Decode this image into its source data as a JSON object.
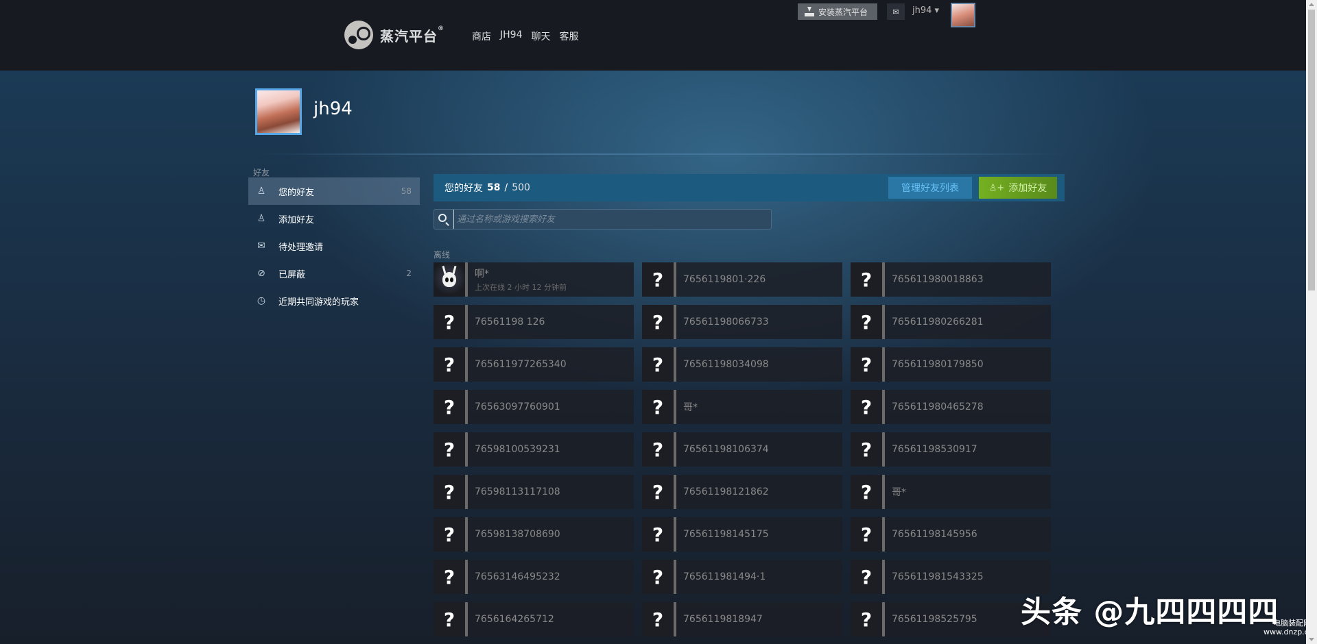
{
  "topbar": {
    "logo_text": "蒸汽平台",
    "logo_sup": "®",
    "nav": [
      "商店",
      "JH94",
      "聊天",
      "客服"
    ],
    "install_label": "安装蒸汽平台",
    "mail_glyph": "✉",
    "account_label": "jh94 ▾"
  },
  "profile": {
    "name": "jh94"
  },
  "sidebar": {
    "heading": "好友",
    "items": [
      {
        "icon": "person-icon",
        "glyph": "♙",
        "label": "您的好友",
        "count": "58"
      },
      {
        "icon": "add-person-icon",
        "glyph": "♙",
        "label": "添加好友",
        "count": ""
      },
      {
        "icon": "envelope-icon",
        "glyph": "✉",
        "label": "待处理邀请",
        "count": ""
      },
      {
        "icon": "blocked-icon",
        "glyph": "⊘",
        "label": "已屏蔽",
        "count": "2"
      },
      {
        "icon": "clock-icon",
        "glyph": "◷",
        "label": "近期共同游戏的玩家",
        "count": ""
      }
    ]
  },
  "friends": {
    "title": "您的好友",
    "count": "58",
    "separator": "/",
    "max": "500",
    "manage_label": "管理好友列表",
    "add_label": "添加好友",
    "add_glyph": "♙+",
    "search_placeholder": "通过名称或游戏搜索好友",
    "offline_label": "离线",
    "list": [
      {
        "name": "啊*",
        "status": "上次在线 2 小时 12 分钟前",
        "avatar": "knight"
      },
      {
        "name": "7656119801·226",
        "status": "",
        "avatar": "unknown"
      },
      {
        "name": "765611980018863",
        "status": "",
        "avatar": "unknown"
      },
      {
        "name": "76561198 126",
        "status": "",
        "avatar": "unknown"
      },
      {
        "name": "76561198066733",
        "status": "",
        "avatar": "unknown"
      },
      {
        "name": "765611980266281",
        "status": "",
        "avatar": "unknown"
      },
      {
        "name": "765611977265340",
        "status": "",
        "avatar": "unknown"
      },
      {
        "name": "76561198034098",
        "status": "",
        "avatar": "unknown"
      },
      {
        "name": "765611980179850",
        "status": "",
        "avatar": "unknown"
      },
      {
        "name": "76563097760901",
        "status": "",
        "avatar": "unknown"
      },
      {
        "name": "哥*",
        "status": "",
        "avatar": "unknown"
      },
      {
        "name": "765611980465278",
        "status": "",
        "avatar": "unknown"
      },
      {
        "name": "76598100539231",
        "status": "",
        "avatar": "unknown"
      },
      {
        "name": "76561198106374",
        "status": "",
        "avatar": "unknown"
      },
      {
        "name": "76561198530917",
        "status": "",
        "avatar": "unknown"
      },
      {
        "name": "76598113117108",
        "status": "",
        "avatar": "unknown"
      },
      {
        "name": "76561198121862",
        "status": "",
        "avatar": "unknown"
      },
      {
        "name": "哥*",
        "status": "",
        "avatar": "unknown"
      },
      {
        "name": "76598138708690",
        "status": "",
        "avatar": "unknown"
      },
      {
        "name": "76561198145175",
        "status": "",
        "avatar": "unknown"
      },
      {
        "name": "76561198145956",
        "status": "",
        "avatar": "unknown"
      },
      {
        "name": "76563146495232",
        "status": "",
        "avatar": "unknown"
      },
      {
        "name": "765611981494·1",
        "status": "",
        "avatar": "unknown"
      },
      {
        "name": "765611981543325",
        "status": "",
        "avatar": "unknown"
      },
      {
        "name": "7656164265712",
        "status": "",
        "avatar": "unknown"
      },
      {
        "name": "7656119818947",
        "status": "",
        "avatar": "unknown"
      },
      {
        "name": "76561198525795",
        "status": "",
        "avatar": "unknown"
      }
    ]
  },
  "watermark": {
    "main": "头条 @九四四四四",
    "small_line1": "电脑装配网",
    "small_line2": "www.dnzp.com"
  },
  "colors": {
    "header_bar": "#1c5a80",
    "add_button": "#75b022",
    "manage_button": "#2a77a6",
    "topbar": "#171a21"
  }
}
